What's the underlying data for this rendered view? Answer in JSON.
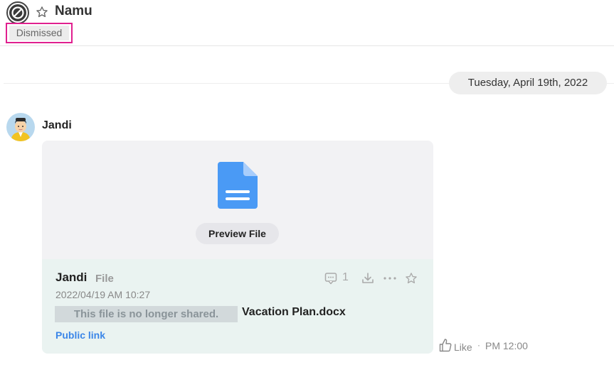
{
  "header": {
    "room_title": "Namu",
    "status_badge": "Dismissed"
  },
  "date_divider": "Tuesday, April 19th, 2022",
  "message": {
    "sender": "Jandi",
    "like_label": "Like",
    "separator": "·",
    "time": "PM 12:00",
    "file_card": {
      "preview_button": "Preview File",
      "sender": "Jandi",
      "type_label": "File",
      "timestamp": "2022/04/19 AM 10:27",
      "unshared_notice": "This file is no longer shared.",
      "file_name": "Vacation Plan.docx",
      "public_link": "Public link",
      "comment_count": "1"
    }
  },
  "colors": {
    "accent_link": "#3b86e8",
    "file_icon": "#4a9af5",
    "highlight_border": "#e0208f",
    "info_background": "#eaf3f1"
  },
  "icons": [
    "room-prohibited-icon",
    "star-icon",
    "file-document-icon",
    "comment-icon",
    "download-icon",
    "more-icon",
    "bookmark-star-icon",
    "thumbs-up-icon"
  ]
}
